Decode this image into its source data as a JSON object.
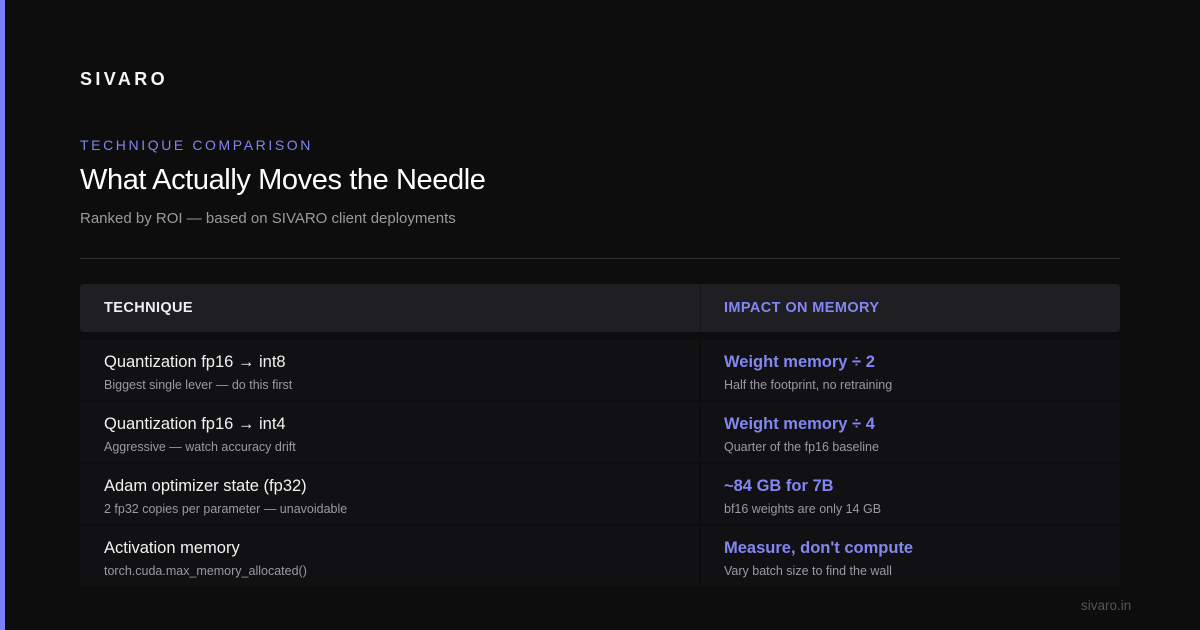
{
  "brand": "SIVARO",
  "eyebrow": "TECHNIQUE COMPARISON",
  "title": "What Actually Moves the Needle",
  "subtitle": "Ranked by ROI — based on SIVARO client deployments",
  "table": {
    "headers": {
      "technique": "TECHNIQUE",
      "impact": "IMPACT ON MEMORY"
    },
    "rows": [
      {
        "technique": "Quantization fp16 → int8",
        "technique_note": "Biggest single lever — do this first",
        "impact": "Weight memory ÷ 2",
        "impact_note": "Half the footprint, no retraining"
      },
      {
        "technique": "Quantization fp16 → int4",
        "technique_note": "Aggressive — watch accuracy drift",
        "impact": "Weight memory ÷ 4",
        "impact_note": "Quarter of the fp16 baseline"
      },
      {
        "technique": "Adam optimizer state (fp32)",
        "technique_note": "2 fp32 copies per parameter — unavoidable",
        "impact": "~84 GB for 7B",
        "impact_note": "bf16 weights are only 14 GB"
      },
      {
        "technique": "Activation memory",
        "technique_note": "torch.cuda.max_memory_allocated()",
        "impact": "Measure, don't compute",
        "impact_note": "Vary batch size to find the wall"
      }
    ]
  },
  "footer": "sivaro.in",
  "colors": {
    "background": "#0d0d0d",
    "accent": "#7b7ff5",
    "header_bg": "#1f1f23",
    "row_bg": "#111113",
    "muted_text": "#9a9aa0"
  }
}
